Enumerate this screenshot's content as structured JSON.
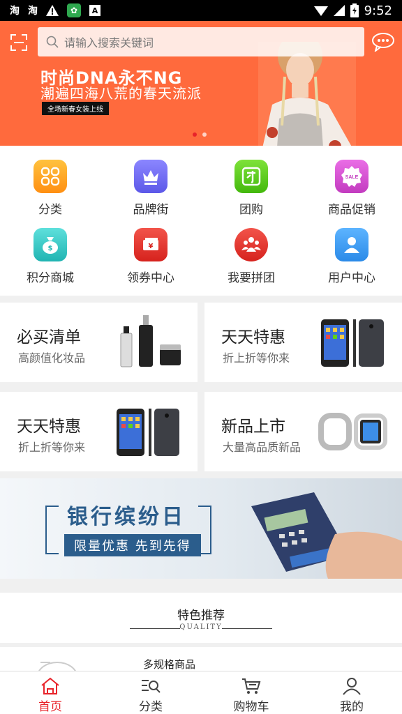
{
  "status_bar": {
    "apps": [
      "淘",
      "淘"
    ],
    "time": "9:52"
  },
  "banner": {
    "search_placeholder": "请输入搜索关键词",
    "headline": "时尚DNA永不NG",
    "subline": "潮遍四海八荒的春天流派",
    "tag": "全场新春女装上线",
    "slide_count": 2,
    "active_slide": 1
  },
  "quick_menu": [
    {
      "label": "分类",
      "icon": "category-icon",
      "color": "#ffa51f"
    },
    {
      "label": "品牌街",
      "icon": "crown-icon",
      "color": "#6f6cf2"
    },
    {
      "label": "团购",
      "icon": "group-buy-icon",
      "color": "#5ed11a"
    },
    {
      "label": "商品促销",
      "icon": "sale-icon",
      "color": "#d94fd6"
    },
    {
      "label": "积分商城",
      "icon": "points-bag-icon",
      "color": "#36c8c6"
    },
    {
      "label": "领券中心",
      "icon": "coupon-icon",
      "color": "#e8332f"
    },
    {
      "label": "我要拼团",
      "icon": "team-icon",
      "color": "#e8332f"
    },
    {
      "label": "用户中心",
      "icon": "user-icon",
      "color": "#3a9ff2"
    }
  ],
  "promo_cards": [
    {
      "title": "必买清单",
      "sub": "高颜值化妆品",
      "art": "cosmetics-image"
    },
    {
      "title": "天天特惠",
      "sub": "折上折等你来",
      "art": "phone-image"
    },
    {
      "title": "天天特惠",
      "sub": "折上折等你来",
      "art": "phone-image"
    },
    {
      "title": "新品上市",
      "sub": "大量高品质新品",
      "art": "smartwatch-image"
    }
  ],
  "bank_banner": {
    "title": "银行缤纷日",
    "sub": "限量优惠 先到先得"
  },
  "feature": {
    "title": "特色推荐",
    "sub": "QUALITY"
  },
  "product": {
    "name": "多规格商品"
  },
  "tabbar": [
    {
      "label": "首页",
      "icon": "home-icon",
      "active": true
    },
    {
      "label": "分类",
      "icon": "category-search-icon",
      "active": false
    },
    {
      "label": "购物车",
      "icon": "cart-icon",
      "active": false
    },
    {
      "label": "我的",
      "icon": "profile-icon",
      "active": false
    }
  ],
  "colors": {
    "accent": "#e8232a",
    "banner_bg": "#ff6a3d",
    "bank_blue": "#2b5d8c"
  }
}
